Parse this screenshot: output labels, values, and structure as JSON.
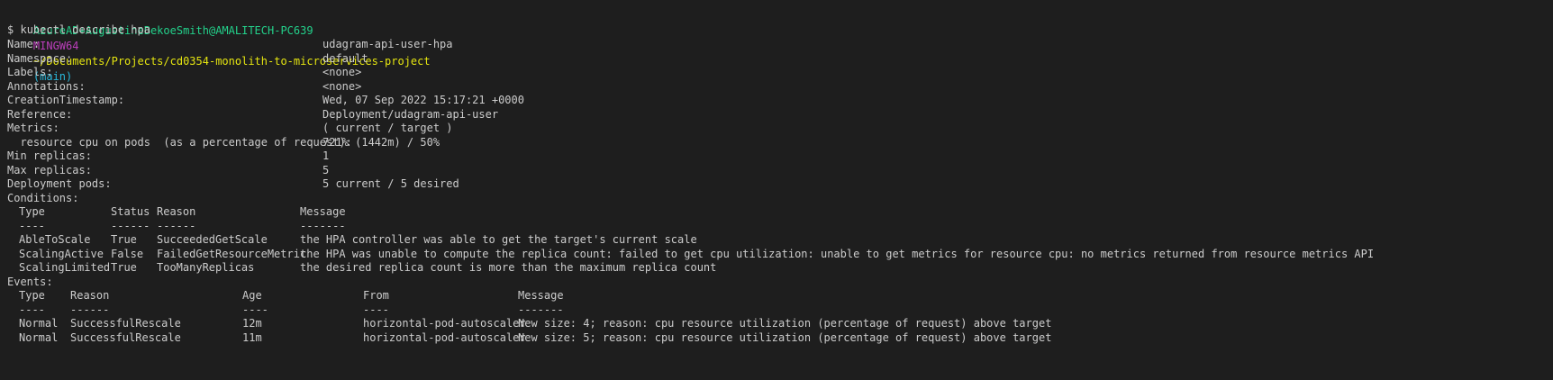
{
  "prompt": {
    "user": "AzureAD+AugustineBekoeSmith@AMALITECH-PC639",
    "shell": "MINGW64",
    "path": "~/Documents/Projects/cd0354-monolith-to-microservices-project",
    "branch": "(main)",
    "symbol": "$",
    "command": "kubectl describe hpa"
  },
  "fields": [
    {
      "label": "Name:",
      "value": "udagram-api-user-hpa"
    },
    {
      "label": "Namespace:",
      "value": "default"
    },
    {
      "label": "Labels:",
      "value": "<none>"
    },
    {
      "label": "Annotations:",
      "value": "<none>"
    },
    {
      "label": "CreationTimestamp:",
      "value": "Wed, 07 Sep 2022 15:17:21 +0000"
    },
    {
      "label": "Reference:",
      "value": "Deployment/udagram-api-user"
    },
    {
      "label": "Metrics:",
      "value": "( current / target )"
    },
    {
      "label": "  resource cpu on pods  (as a percentage of request):",
      "value": "721% (1442m) / 50%"
    },
    {
      "label": "Min replicas:",
      "value": "1"
    },
    {
      "label": "Max replicas:",
      "value": "5"
    },
    {
      "label": "Deployment pods:",
      "value": "5 current / 5 desired"
    }
  ],
  "conditions": {
    "title": "Conditions:",
    "headers": [
      "Type",
      "Status",
      "Reason",
      "Message"
    ],
    "dashes": [
      "----",
      "------",
      "------",
      "-------"
    ],
    "rows": [
      [
        "AbleToScale",
        "True",
        "SucceededGetScale",
        "the HPA controller was able to get the target's current scale"
      ],
      [
        "ScalingActive",
        "False",
        "FailedGetResourceMetric",
        "the HPA was unable to compute the replica count: failed to get cpu utilization: unable to get metrics for resource cpu: no metrics returned from resource metrics API"
      ],
      [
        "ScalingLimited",
        "True",
        "TooManyReplicas",
        "the desired replica count is more than the maximum replica count"
      ]
    ]
  },
  "events": {
    "title": "Events:",
    "headers": [
      "Type",
      "Reason",
      "Age",
      "From",
      "Message"
    ],
    "dashes": [
      "----",
      "------",
      "----",
      "----",
      "-------"
    ],
    "rows": [
      [
        "Normal",
        "SuccessfulRescale",
        "12m",
        "horizontal-pod-autoscaler",
        "New size: 4; reason: cpu resource utilization (percentage of request) above target"
      ],
      [
        "Normal",
        "SuccessfulRescale",
        "11m",
        "horizontal-pod-autoscaler",
        "New size: 5; reason: cpu resource utilization (percentage of request) above target"
      ]
    ]
  },
  "colors": {
    "background": "#1e1e1e",
    "text": "#cccccc",
    "user": "#23d18b",
    "shell": "#bc3fbc",
    "path": "#e5e510",
    "branch": "#29b8db"
  }
}
